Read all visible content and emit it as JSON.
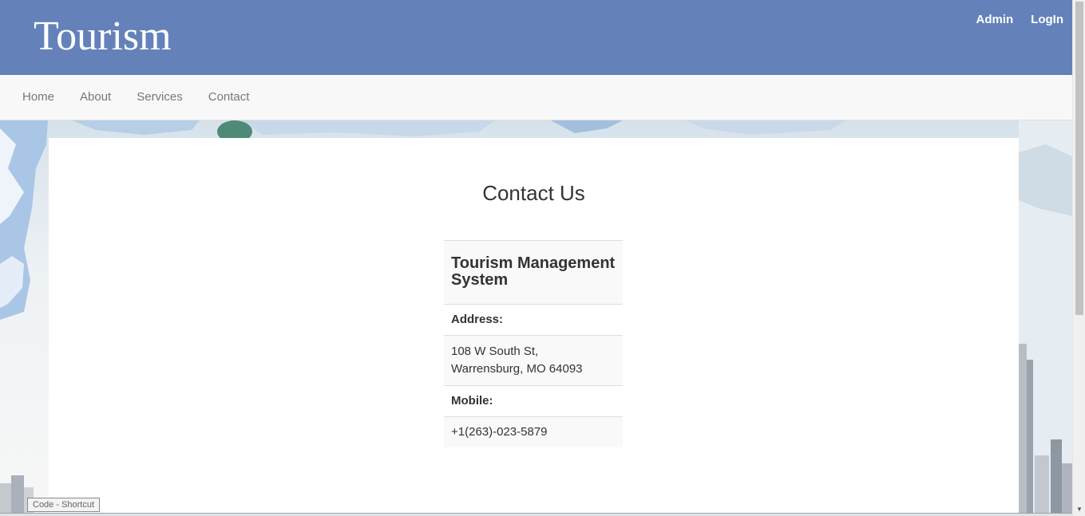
{
  "header": {
    "brand": "Tourism",
    "links": [
      "Admin",
      "LogIn"
    ]
  },
  "nav": {
    "items": [
      "Home",
      "About",
      "Services",
      "Contact"
    ]
  },
  "main": {
    "title": "Contact Us",
    "card": {
      "heading": "Tourism Management System",
      "address_label": "Address:",
      "address_line1": "108 W South St,",
      "address_line2": "Warrensburg, MO 64093",
      "mobile_label": "Mobile:",
      "mobile_value": "+1(263)-023-5879"
    }
  },
  "desktop": {
    "tooltip": "Code - Shortcut"
  },
  "colors": {
    "banner": "#6482b9",
    "nav_bg": "#f8f8f8",
    "panel_bg": "#ffffff"
  }
}
